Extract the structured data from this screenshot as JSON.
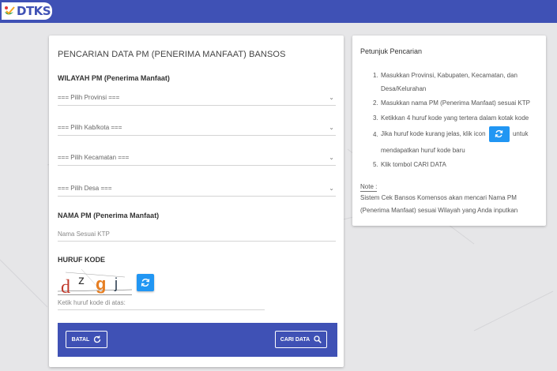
{
  "app": {
    "logo_text": "DTKS",
    "brand_color": "#3f51b5",
    "accent_color": "#2196f3"
  },
  "form": {
    "title": "PENCARIAN DATA PM (PENERIMA MANFAAT) BANSOS",
    "wilayah_label": "WILAYAH PM (Penerima Manfaat)",
    "selects": [
      {
        "selected": "=== Pilih Provinsi ==="
      },
      {
        "selected": "=== Pilih Kab/kota ==="
      },
      {
        "selected": "=== Pilih Kecamatan ==="
      },
      {
        "selected": "=== Pilih Desa ==="
      }
    ],
    "nama_label": "NAMA PM (Penerima Manfaat)",
    "nama_placeholder": "Nama Sesuai KTP",
    "kode_label": "HURUF KODE",
    "captcha_chars": [
      "d",
      "z",
      "g",
      "j"
    ],
    "kode_placeholder": "Ketik huruf kode di atas:",
    "batal_label": "BATAL",
    "cari_label": "CARI DATA",
    "icons": {
      "refresh": "refresh-icon",
      "search": "search-icon",
      "dropdown": "chevron-down-icon"
    }
  },
  "guide": {
    "title": "Petunjuk Pencarian",
    "steps": [
      {
        "num": "1.",
        "text": "Masukkan Provinsi, Kabupaten, Kecamatan, dan Desa/Kelurahan"
      },
      {
        "num": "2.",
        "text": "Masukkan nama PM (Penerima Manfaat) sesuai KTP"
      },
      {
        "num": "3.",
        "text": "Ketikkan 4 huruf kode yang tertera dalam kotak kode"
      },
      {
        "num": "4.",
        "text_before": "Jika huruf kode kurang jelas, klik icon",
        "text_after": "untuk mendapatkan huruf kode baru"
      },
      {
        "num": "5.",
        "text": "Klik tombol CARI DATA"
      }
    ],
    "note_label": "Note :",
    "note_text": "Sistem Cek Bansos Komensos akan mencari Nama PM (Penerima Manfaat) sesuai Wilayah yang Anda inputkan"
  }
}
